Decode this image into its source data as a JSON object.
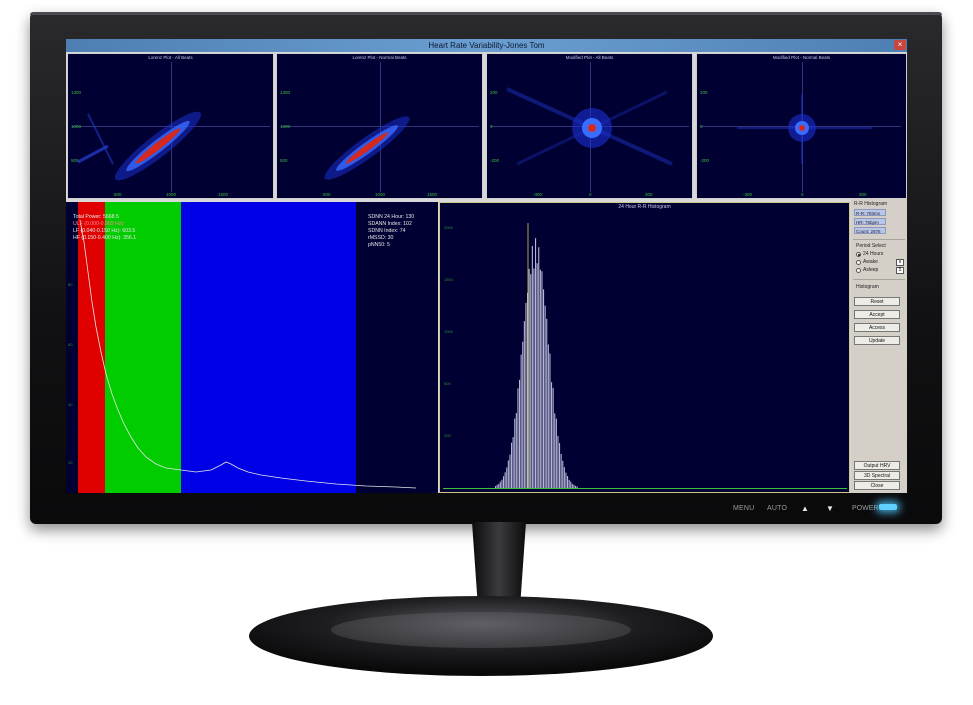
{
  "window": {
    "title": "Heart Rate Variability-Jones Tom",
    "close": "×"
  },
  "plots": [
    {
      "title": "Lorenz Plot - All Beats",
      "y": [
        "1300",
        "1000",
        "500"
      ],
      "x": [
        "500",
        "1000",
        "1500"
      ]
    },
    {
      "title": "Lorenz Plot - Normal Beats",
      "y": [
        "1300",
        "1000",
        "500"
      ],
      "x": [
        "500",
        "1000",
        "1500"
      ]
    },
    {
      "title": "Modified Plot - All Beats",
      "y": [
        "200",
        "0",
        "-200"
      ],
      "x": [
        "-300",
        "0",
        "300"
      ]
    },
    {
      "title": "Modified Plot - Normal Beats",
      "y": [
        "200",
        "0",
        "-200"
      ],
      "x": [
        "-300",
        "0",
        "300"
      ]
    }
  ],
  "spectrum": {
    "total": "Total Power: 5668.5",
    "ulf": "ULF (0.000-0.003 Hz):",
    "lf": "LF (0.040-0.150 Hz): 603.5",
    "hf": "HF (0.150-0.400 Hz): 356.1",
    "yticks": [
      "80",
      "60",
      "40",
      "20"
    ],
    "stats": [
      "SDNN 24 Hour: 130",
      "SDANN Index: 102",
      "SDNN Index: 74",
      "rMSSD: 30",
      "pNN50: 5"
    ]
  },
  "histogram": {
    "title": "24 Hour R-R Histogram",
    "yticks": [
      "2000",
      "1500",
      "1000",
      "500",
      "200"
    ]
  },
  "sidebar": {
    "rr_header": "R-R Histogram",
    "rr_fields": [
      "R-R: 783ms",
      "HR: 76bpm",
      "Count: 2876"
    ],
    "period_label": "Period Select",
    "periods": [
      "24 Hours",
      "Awake",
      "Asleep"
    ],
    "spin_up": "∨",
    "spin_value": "5",
    "histogram_label": "Histogram",
    "buttons": [
      "Reset",
      "Accept",
      "Access",
      "Update"
    ],
    "bottom_buttons": [
      "Output HRV",
      "3D Spectral",
      "Close"
    ]
  },
  "monitor": {
    "controls": [
      "MENU",
      "AUTO",
      "▲",
      "▼",
      "POWER"
    ]
  },
  "colors": {
    "plot_bg": "#000033",
    "ulf_band": "#e00000",
    "lf_band": "#00cc00",
    "hf_band": "#0000e6",
    "axis_tick": "#3fbf3f"
  }
}
